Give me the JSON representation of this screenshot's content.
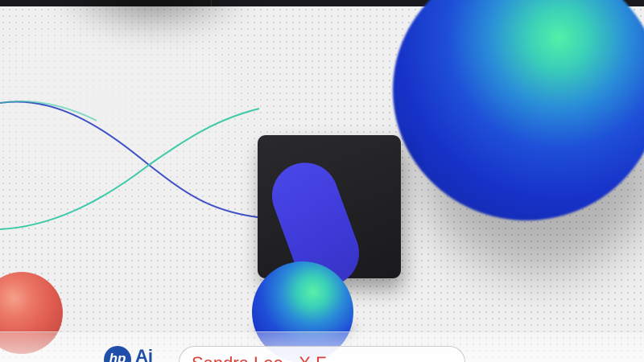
{
  "scene": {
    "description_tag": "",
    "colors": {
      "background": "#ededed",
      "topbar": "#1a1a1c",
      "card": "#1f1f22",
      "pill": "#4a47e8",
      "sphere_green": "#52f0a8",
      "sphere_blue": "#1732c8",
      "red_sphere": "#dd5a4e",
      "wave_teal": "#3ec9a8",
      "wave_blue": "#3f4fc8",
      "caption_text": "#d9423a",
      "logo_blue": "#1f4fa8"
    }
  },
  "overlay": {
    "hp_logo": "hp",
    "ai_logo": "Ai",
    "caption": "Sandra Lee - X F..."
  },
  "icons": [
    "hp-logo-icon"
  ]
}
